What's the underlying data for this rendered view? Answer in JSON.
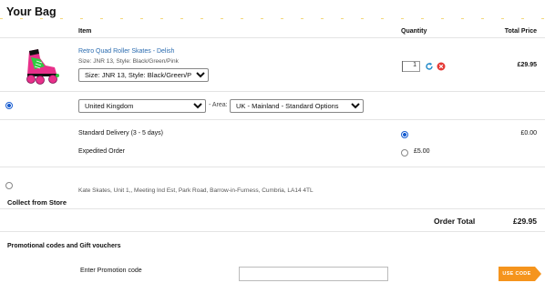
{
  "page": {
    "title": "Your Bag"
  },
  "table": {
    "headers": {
      "item": "Item",
      "quantity": "Quantity",
      "total_price": "Total Price"
    }
  },
  "product": {
    "name": "Retro Quad Roller Skates - Delish",
    "meta": "Size: JNR 13, Style: Black/Green/Pink",
    "variant_selected": "Size: JNR 13, Style: Black/Green/Pink",
    "quantity": "1",
    "price": "£29.95",
    "image_icon": "roller-skate-icon"
  },
  "delivery": {
    "country_selected": "United Kingdom",
    "area_label": "- Area:",
    "zone_selected": "UK - Mainland - Standard Options",
    "options": [
      {
        "label": "Standard Delivery (3 - 5 days)",
        "price": "£0.00",
        "selected": true
      },
      {
        "label": "Expedited Order",
        "price": "£5.00",
        "selected": false
      }
    ]
  },
  "collect": {
    "address": "Kate Skates, Unit 1,, Meeting Ind Est, Park Road, Barrow-in-Furness, Cumbria, LA14 4TL",
    "label": "Collect from Store"
  },
  "order": {
    "total_label": "Order Total",
    "total_value": "£29.95"
  },
  "promo": {
    "heading": "Promotional codes and Gift vouchers",
    "label": "Enter Promotion code",
    "value": "",
    "button_label": "USE CODE"
  },
  "colors": {
    "accent": "#f5941d",
    "link": "#2b6cb0",
    "remove": "#e53935",
    "refresh": "#1e88c8"
  }
}
